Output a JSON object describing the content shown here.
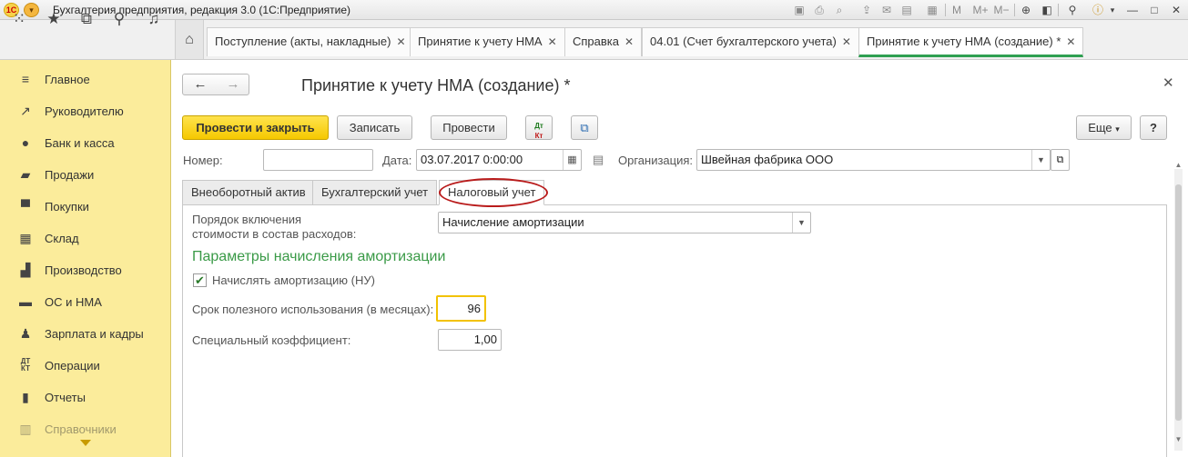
{
  "window": {
    "logo": "1С",
    "title": "Бухгалтерия предприятия, редакция 3.0  (1С:Предприятие)",
    "toolbar_icons": [
      "save-icon",
      "print-icon",
      "preview-icon",
      "export-icon",
      "mail-icon",
      "calendar-icon",
      "memory-m-icon",
      "memory-plus-icon",
      "memory-minus-icon",
      "zoom-icon",
      "panel-icon",
      "tools-icon",
      "info-icon",
      "minimize-icon",
      "maximize-icon",
      "close-icon"
    ],
    "memory_labels": [
      "M",
      "M+",
      "M−"
    ]
  },
  "top_panel": {
    "icons": [
      "apps-grid-icon",
      "favorites-star-icon",
      "history-icon",
      "search-icon",
      "notifications-bell-icon"
    ],
    "home_icon": "home-icon",
    "tabs": [
      {
        "label": "Поступление (акты, накладные)"
      },
      {
        "label": "Принятие к учету НМА"
      },
      {
        "label": "Справка"
      },
      {
        "label": "04.01 (Счет бухгалтерского учета)"
      },
      {
        "label": "Принятие к учету НМА (создание) *"
      }
    ]
  },
  "sidebar": {
    "items": [
      {
        "label": "Главное",
        "icon": "menu-lines-icon"
      },
      {
        "label": "Руководителю",
        "icon": "trend-icon"
      },
      {
        "label": "Банк и касса",
        "icon": "coin-icon"
      },
      {
        "label": "Продажи",
        "icon": "cart-icon"
      },
      {
        "label": "Покупки",
        "icon": "basket-icon"
      },
      {
        "label": "Склад",
        "icon": "warehouse-icon"
      },
      {
        "label": "Производство",
        "icon": "factory-icon"
      },
      {
        "label": "ОС и НМА",
        "icon": "truck-icon"
      },
      {
        "label": "Зарплата и кадры",
        "icon": "person-icon"
      },
      {
        "label": "Операции",
        "icon": "dt-kt-icon"
      },
      {
        "label": "Отчеты",
        "icon": "bar-chart-icon"
      },
      {
        "label": "Справочники",
        "icon": "book-icon"
      }
    ]
  },
  "form": {
    "title": "Принятие к учету НМА (создание) *",
    "toolbar": {
      "post_close": "Провести и закрыть",
      "save": "Записать",
      "post": "Провести",
      "dtkt_top": "Дт",
      "dtkt_bottom": "Кт",
      "more": "Еще",
      "help": "?"
    },
    "header": {
      "number_label": "Номер:",
      "number_value": "",
      "date_label": "Дата:",
      "date_value": "03.07.2017  0:00:00",
      "org_label": "Организация:",
      "org_value": "Швейная фабрика ООО"
    },
    "tabs": [
      {
        "label": "Внеоборотный актив"
      },
      {
        "label": "Бухгалтерский учет"
      },
      {
        "label": "Налоговый учет"
      }
    ],
    "tax": {
      "order_label_line1": "Порядок включения",
      "order_label_line2": "стоимости в состав расходов:",
      "order_value": "Начисление амортизации",
      "section_title": "Параметры начисления амортизации",
      "charge_checkbox_label": "Начислять амортизацию (НУ)",
      "charge_checked": true,
      "useful_life_label": "Срок полезного использования (в месяцах):",
      "useful_life_value": "96",
      "coef_label": "Специальный коэффициент:",
      "coef_value": "1,00"
    }
  },
  "colors": {
    "sidebar_bg": "#fbec9b",
    "primary_button": "#f5c800",
    "active_tab_underline": "#2fa052",
    "section_title": "#3a9a47",
    "highlight_ellipse": "#b91c1c"
  }
}
